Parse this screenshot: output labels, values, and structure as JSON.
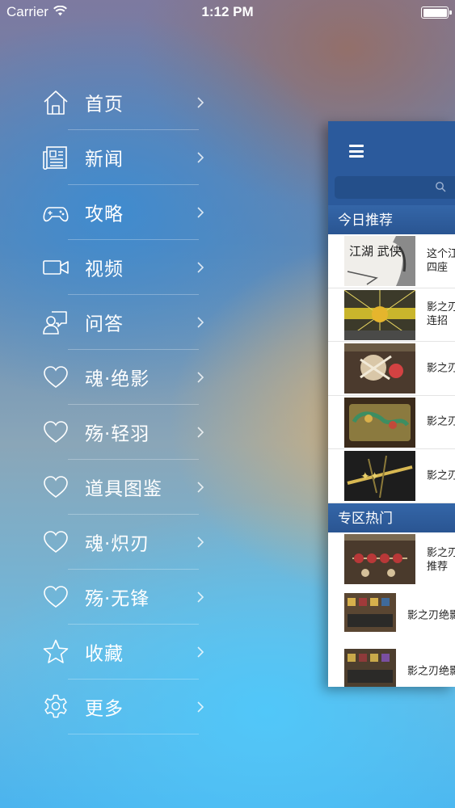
{
  "status_bar": {
    "carrier": "Carrier",
    "time": "1:12 PM"
  },
  "menu": {
    "items": [
      {
        "label": "首页",
        "icon": "home-icon"
      },
      {
        "label": "新闻",
        "icon": "newspaper-icon"
      },
      {
        "label": "攻略",
        "icon": "gamepad-icon"
      },
      {
        "label": "视频",
        "icon": "video-camera-icon"
      },
      {
        "label": "问答",
        "icon": "chat-user-icon"
      },
      {
        "label": "魂·绝影",
        "icon": "heart-icon"
      },
      {
        "label": "殇·轻羽",
        "icon": "heart-icon"
      },
      {
        "label": "道具图鉴",
        "icon": "heart-icon"
      },
      {
        "label": "魂·炽刃",
        "icon": "heart-icon"
      },
      {
        "label": "殇·无锋",
        "icon": "heart-icon"
      },
      {
        "label": "收藏",
        "icon": "star-icon"
      },
      {
        "label": "更多",
        "icon": "gear-icon"
      }
    ]
  },
  "preview": {
    "today_title": "今日推荐",
    "today_items": [
      {
        "line1": "这个江",
        "line2": "四座",
        "thumb_text": "江湖 武侠"
      },
      {
        "line1": "影之刃",
        "line2": "连招"
      },
      {
        "line1": "影之刃",
        "line2": ""
      },
      {
        "line1": "影之刃",
        "line2": ""
      },
      {
        "line1": "影之刃",
        "line2": ""
      }
    ],
    "hot_title": "专区热门",
    "hot_items": [
      {
        "line1": "影之刃",
        "line2": "推荐"
      },
      {
        "line1": "影之刃绝影",
        "line2": ""
      },
      {
        "line1": "影之刃绝影",
        "line2": ""
      }
    ]
  },
  "colors": {
    "nav_blue": "#2b5a9c",
    "menu_text": "#ffffff"
  }
}
